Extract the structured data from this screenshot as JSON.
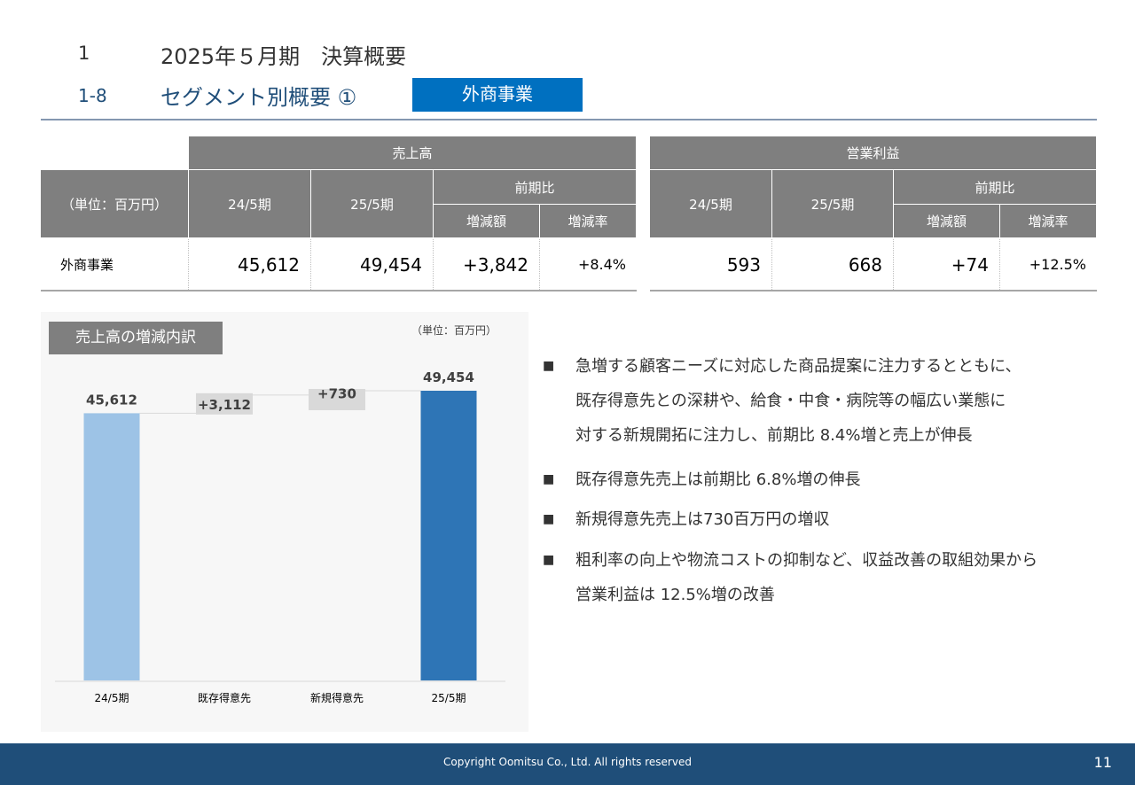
{
  "header": {
    "section_number": "1",
    "section_title": "2025年５月期　決算概要",
    "subsection_number": "1-8",
    "subsection_title": "セグメント別概要 ①",
    "segment_tag": "外商事業"
  },
  "table": {
    "unit_label": "（単位：百万円）",
    "sales_header": "売上高",
    "profit_header": "営業利益",
    "period_prev": "24/5期",
    "period_curr": "25/5期",
    "yoy_header": "前期比",
    "diff_amount": "増減額",
    "diff_rate": "増減率",
    "row_label": "外商事業",
    "sales": {
      "prev": "45,612",
      "curr": "49,454",
      "diff": "+3,842",
      "rate": "+8.4%"
    },
    "profit": {
      "prev": "593",
      "curr": "668",
      "diff": "+74",
      "rate": "+12.5%"
    }
  },
  "chart_title": "売上高の増減内訳",
  "chart_unit": "（単位：百万円）",
  "chart_data": {
    "type": "bar",
    "subtype": "waterfall",
    "categories": [
      "24/5期",
      "既存得意先",
      "新規得意先",
      "25/5期"
    ],
    "values": [
      45612,
      3112,
      730,
      49454
    ],
    "labels": [
      "45,612",
      "+3,112",
      "+730",
      "49,454"
    ],
    "kinds": [
      "total",
      "increase",
      "increase",
      "total"
    ],
    "colors": {
      "start_total": "#9dc3e6",
      "increase": "#d9d9d9",
      "end_total": "#2e75b6"
    },
    "ylim": [
      0,
      49454
    ],
    "grid": false,
    "legend": "none"
  },
  "bullets": [
    {
      "marker": "■",
      "lines": [
        "急増する顧客ニーズに対応した商品提案に注力するとともに、",
        "既存得意先との深耕や、給食・中食・病院等の幅広い業態に",
        "対する新規開拓に注力し、前期比 8.4%増と売上が伸長"
      ]
    },
    {
      "marker": "■",
      "lines": [
        "既存得意先売上は前期比 6.8%増の伸長"
      ]
    },
    {
      "marker": "■",
      "lines": [
        "新規得意先売上は730百万円の増収"
      ]
    },
    {
      "marker": "■",
      "lines": [
        "粗利率の向上や物流コストの抑制など、収益改善の取組効果から",
        "営業利益は 12.5%増の改善"
      ]
    }
  ],
  "footer": {
    "copyright": "Copyright Oomitsu Co., Ltd. All rights reserved",
    "page_number": "11"
  }
}
